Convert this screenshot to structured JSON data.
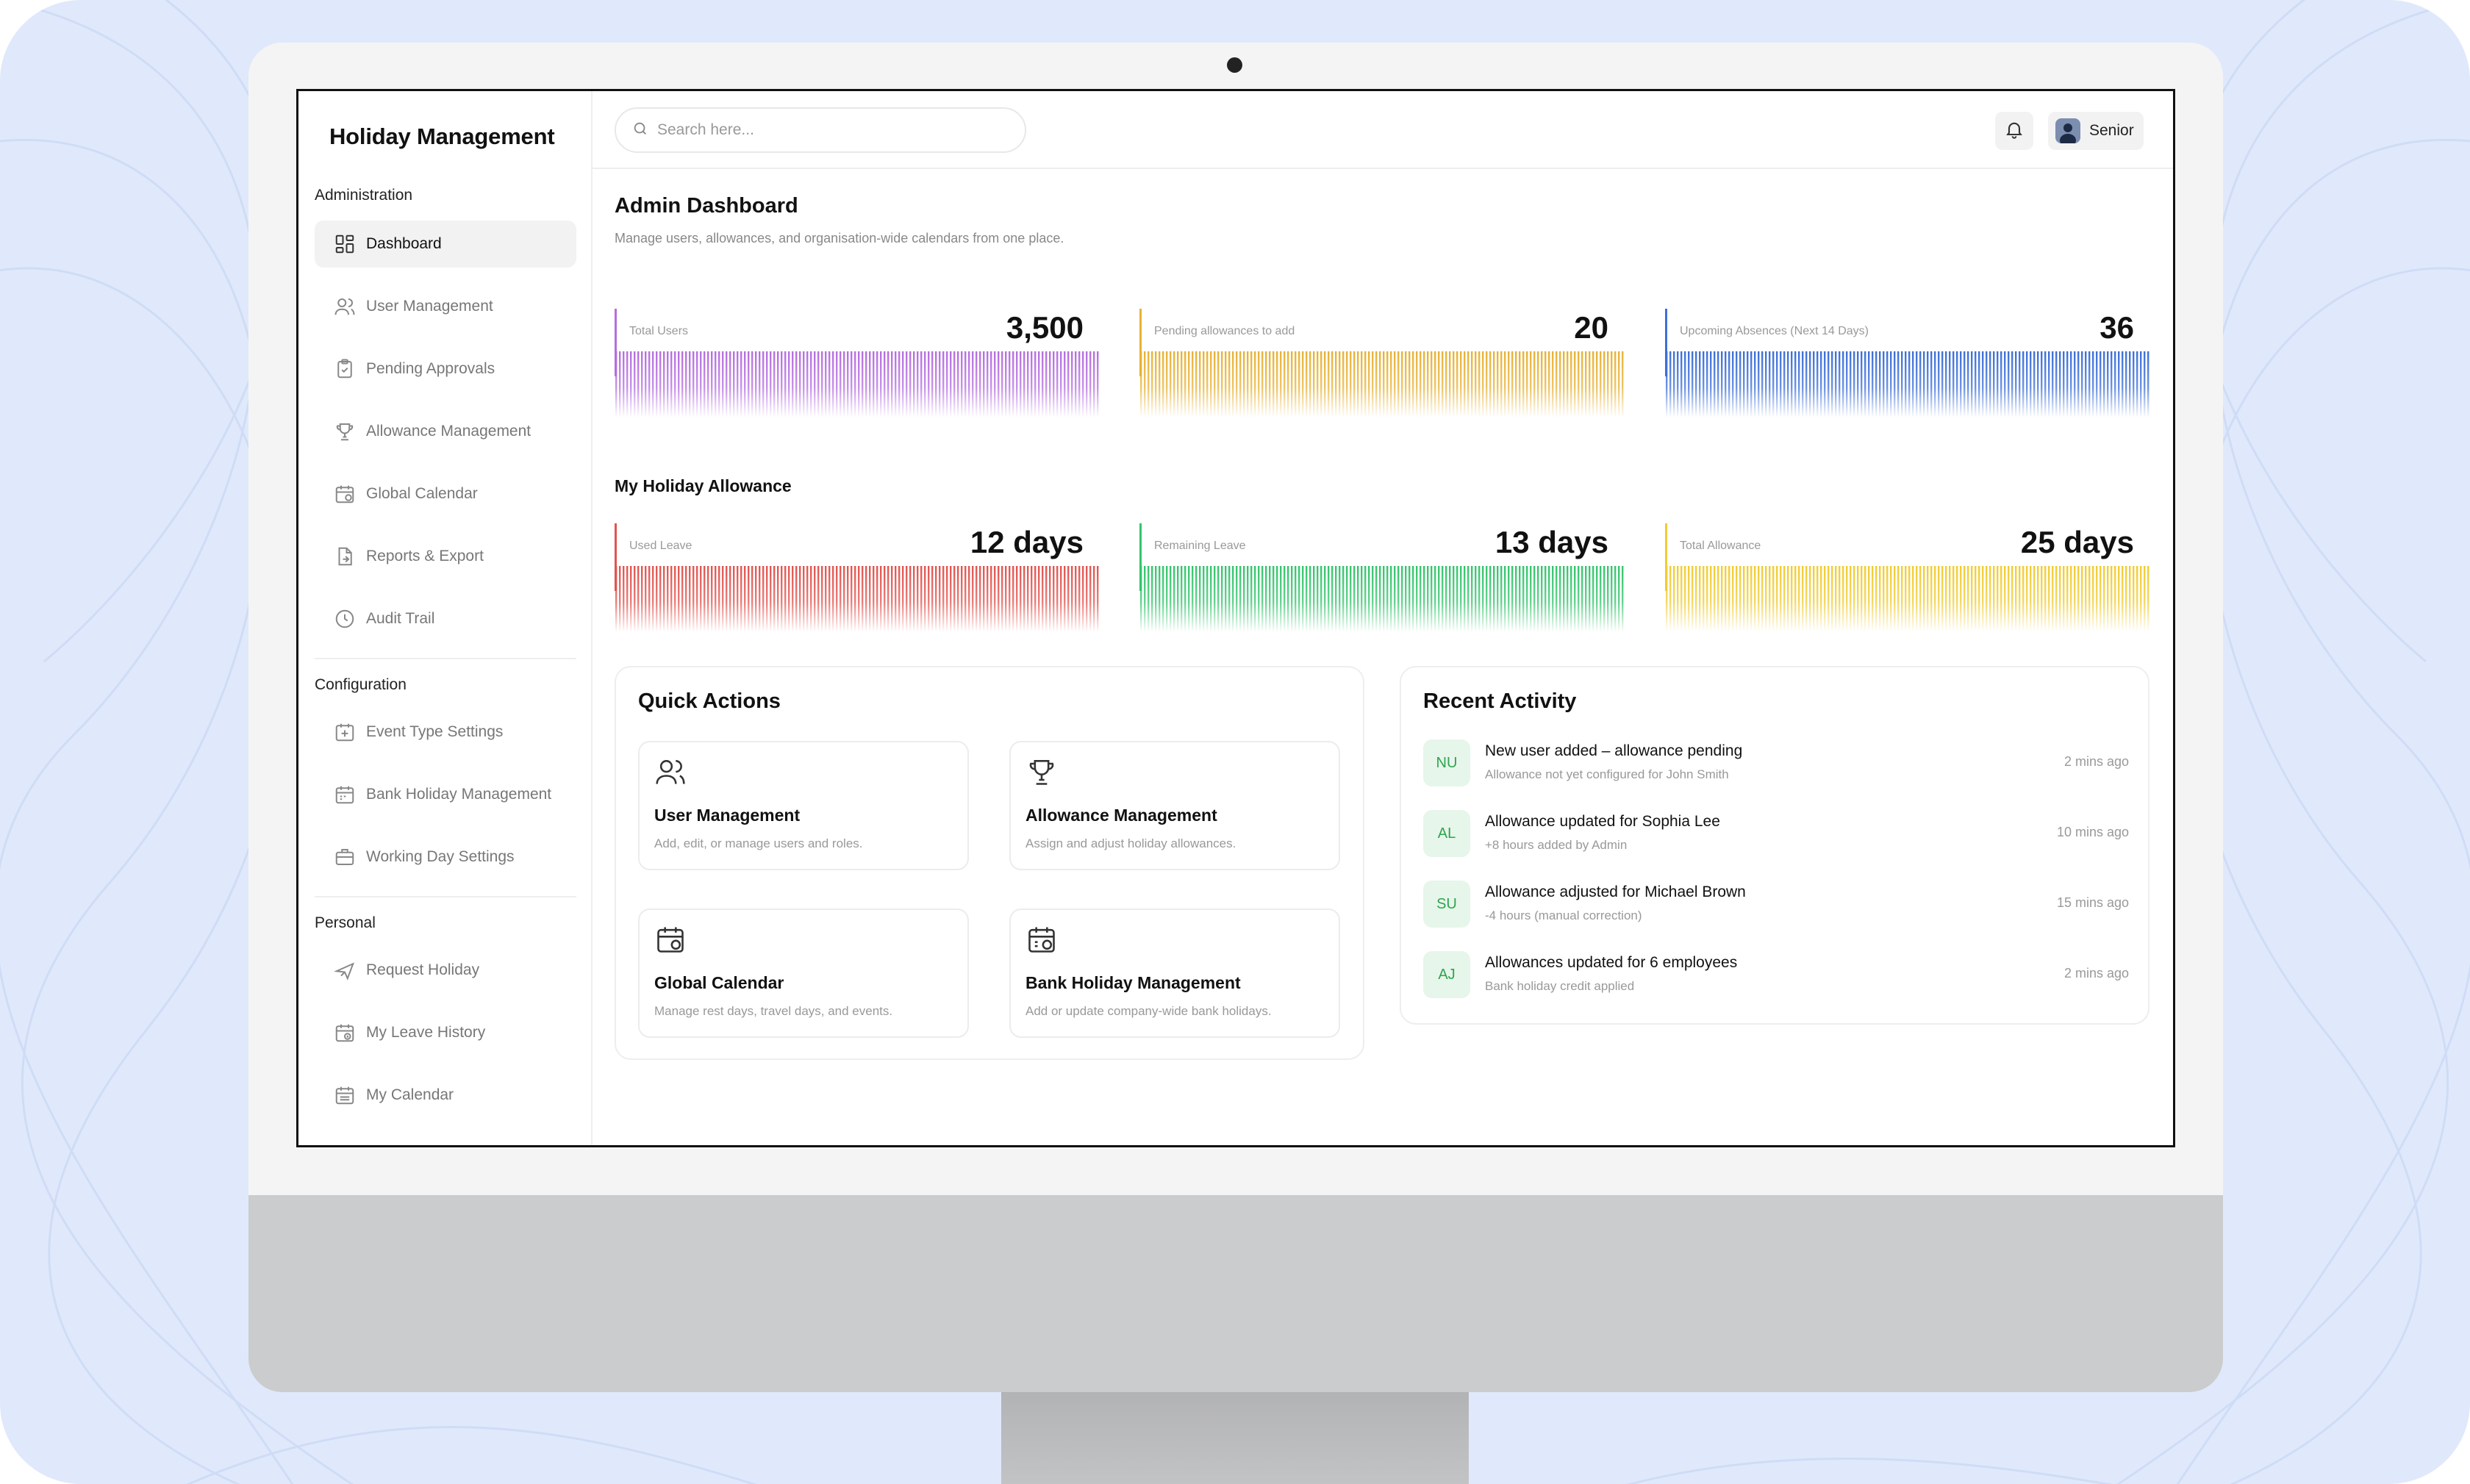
{
  "app": {
    "title": "Holiday Management"
  },
  "sidebar": {
    "sections": [
      {
        "title": "Administration",
        "items": [
          {
            "label": "Dashboard",
            "icon": "dashboard-icon",
            "active": true
          },
          {
            "label": "User Management",
            "icon": "users-icon"
          },
          {
            "label": "Pending Approvals",
            "icon": "clipboard-check-icon"
          },
          {
            "label": "Allowance Management",
            "icon": "trophy-icon"
          },
          {
            "label": "Global Calendar",
            "icon": "calendar-icon"
          },
          {
            "label": "Reports & Export",
            "icon": "export-file-icon"
          },
          {
            "label": "Audit Trail",
            "icon": "clock-icon"
          }
        ]
      },
      {
        "title": "Configuration",
        "items": [
          {
            "label": "Event Type Settings",
            "icon": "calendar-plus-icon"
          },
          {
            "label": "Bank Holiday Management",
            "icon": "calendar-bank-icon"
          },
          {
            "label": "Working Day Settings",
            "icon": "briefcase-icon"
          }
        ]
      },
      {
        "title": "Personal",
        "items": [
          {
            "label": "Request Holiday",
            "icon": "plane-icon"
          },
          {
            "label": "My Leave History",
            "icon": "calendar-history-icon"
          },
          {
            "label": "My Calendar",
            "icon": "calendar-grid-icon"
          }
        ]
      }
    ]
  },
  "topbar": {
    "search_placeholder": "Search here...",
    "user_name": "Senior"
  },
  "header": {
    "title": "Admin Dashboard",
    "subtitle": "Manage users, allowances, and organisation-wide calendars from one place."
  },
  "stats": [
    {
      "label": "Total Users",
      "value": "3,500",
      "color": "#b56ee0"
    },
    {
      "label": "Pending allowances to add",
      "value": "20",
      "color": "#e8b236"
    },
    {
      "label": "Upcoming Absences (Next 14 Days)",
      "value": "36",
      "color": "#3d6fd8"
    }
  ],
  "allowance": {
    "title": "My Holiday Allowance",
    "stats": [
      {
        "label": "Used Leave",
        "value": "12 days",
        "color": "#e2544f"
      },
      {
        "label": "Remaining Leave",
        "value": "13 days",
        "color": "#34c46c"
      },
      {
        "label": "Total Allowance",
        "value": "25 days",
        "color": "#f1cc32"
      }
    ]
  },
  "quick_actions": {
    "title": "Quick Actions",
    "items": [
      {
        "title": "User Management",
        "desc": "Add, edit, or manage users and roles.",
        "icon": "users-icon"
      },
      {
        "title": "Allowance Management",
        "desc": "Assign and adjust holiday allowances.",
        "icon": "trophy-icon"
      },
      {
        "title": "Global Calendar",
        "desc": "Manage rest days, travel days, and events.",
        "icon": "calendar-icon"
      },
      {
        "title": "Bank Holiday Management",
        "desc": "Add or update company-wide bank holidays.",
        "icon": "calendar-bank-icon"
      }
    ]
  },
  "recent_activity": {
    "title": "Recent Activity",
    "items": [
      {
        "initials": "NU",
        "title": "New user added – allowance pending",
        "desc": "Allowance not yet configured for John Smith",
        "time": "2 mins ago"
      },
      {
        "initials": "AL",
        "title": "Allowance updated for Sophia Lee",
        "desc": "+8 hours added by Admin",
        "time": "10 mins ago"
      },
      {
        "initials": "SU",
        "title": "Allowance adjusted for Michael Brown",
        "desc": "-4 hours (manual correction)",
        "time": "15 mins ago"
      },
      {
        "initials": "AJ",
        "title": "Allowances updated for 6 employees",
        "desc": "Bank holiday credit applied",
        "time": "2 mins ago"
      }
    ]
  }
}
